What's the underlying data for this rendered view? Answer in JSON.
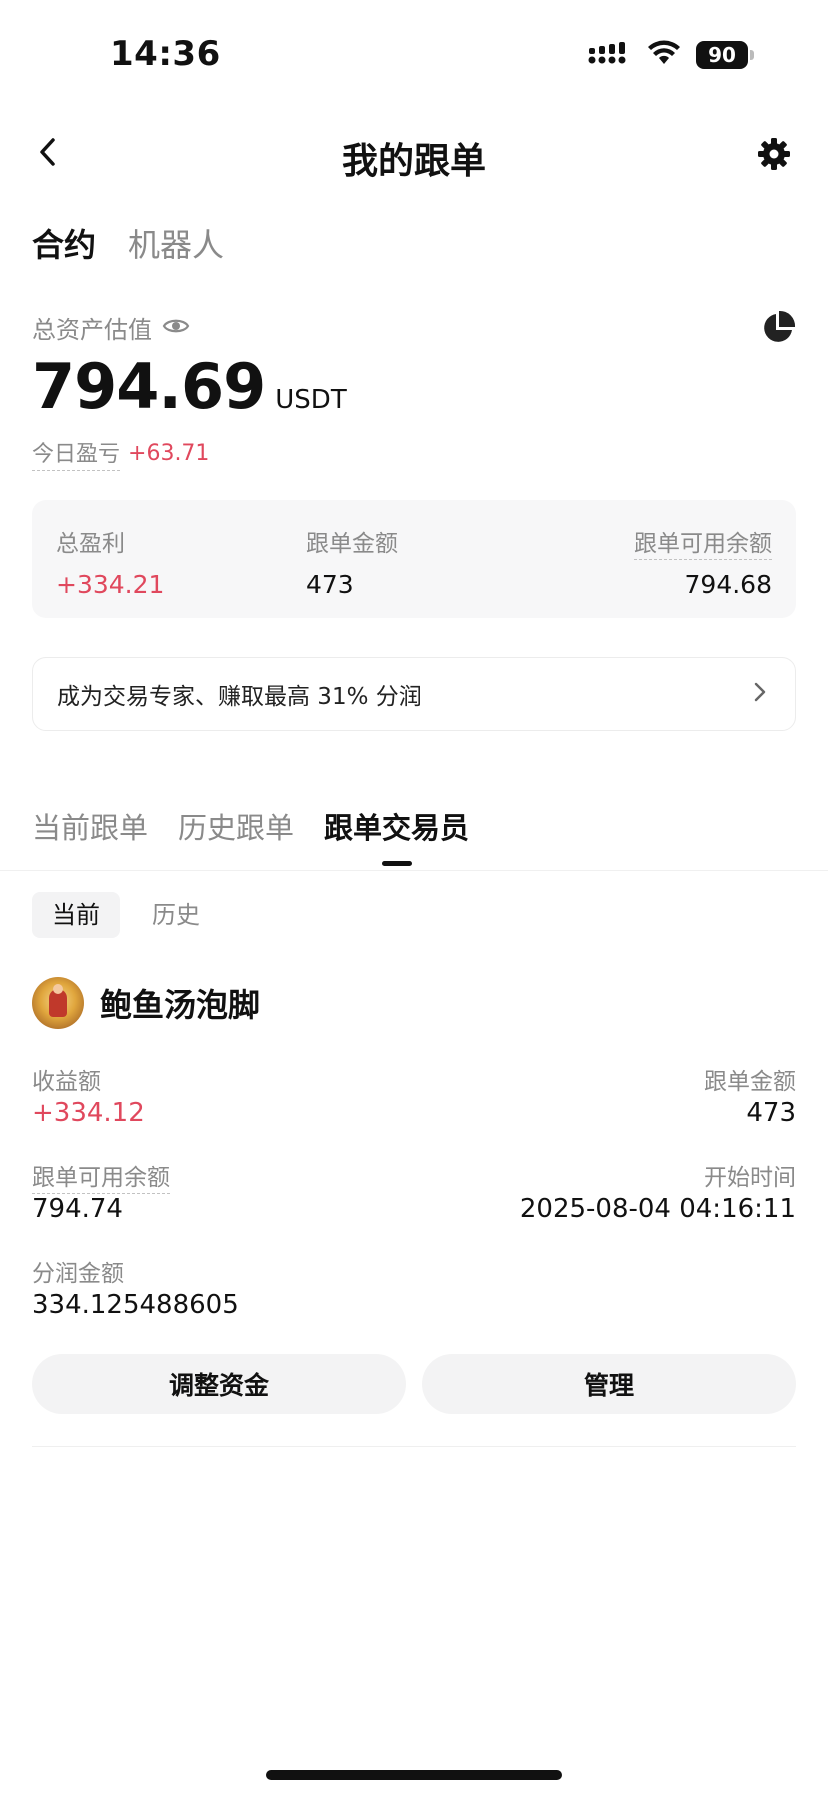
{
  "status_bar": {
    "time": "14:36",
    "battery": "90"
  },
  "nav": {
    "title": "我的跟单",
    "back_icon": "chevron-left-icon",
    "settings_icon": "gear-icon"
  },
  "top_tabs": [
    {
      "label": "合约",
      "active": true
    },
    {
      "label": "机器人",
      "active": false
    }
  ],
  "asset": {
    "label": "总资产估值",
    "value": "794.69",
    "unit": "USDT",
    "today_pnl_label": "今日盈亏",
    "today_pnl_value": "+63.71"
  },
  "summary": {
    "total_profit_label": "总盈利",
    "total_profit_value": "+334.21",
    "copy_amount_label": "跟单金额",
    "copy_amount_value": "473",
    "available_label": "跟单可用余额",
    "available_value": "794.68"
  },
  "promo": {
    "text": "成为交易专家、赚取最高 31% 分润"
  },
  "section_tabs": [
    {
      "label": "当前跟单",
      "active": false
    },
    {
      "label": "历史跟单",
      "active": false
    },
    {
      "label": "跟单交易员",
      "active": true
    }
  ],
  "sub_tabs": [
    {
      "label": "当前",
      "active": true
    },
    {
      "label": "历史",
      "active": false
    }
  ],
  "trader": {
    "name": "鲍鱼汤泡脚",
    "profit_label": "收益额",
    "profit_value": "+334.12",
    "copy_amount_label": "跟单金额",
    "copy_amount_value": "473",
    "available_label": "跟单可用余额",
    "available_value": "794.74",
    "start_time_label": "开始时间",
    "start_time_value": "2025-08-04 04:16:11",
    "share_label": "分润金额",
    "share_value": "334.125488605"
  },
  "actions": {
    "adjust_label": "调整资金",
    "manage_label": "管理"
  },
  "colors": {
    "profit_red": "#e0485d",
    "muted_gray": "#8a8a8a",
    "card_bg": "#f7f7f8"
  }
}
